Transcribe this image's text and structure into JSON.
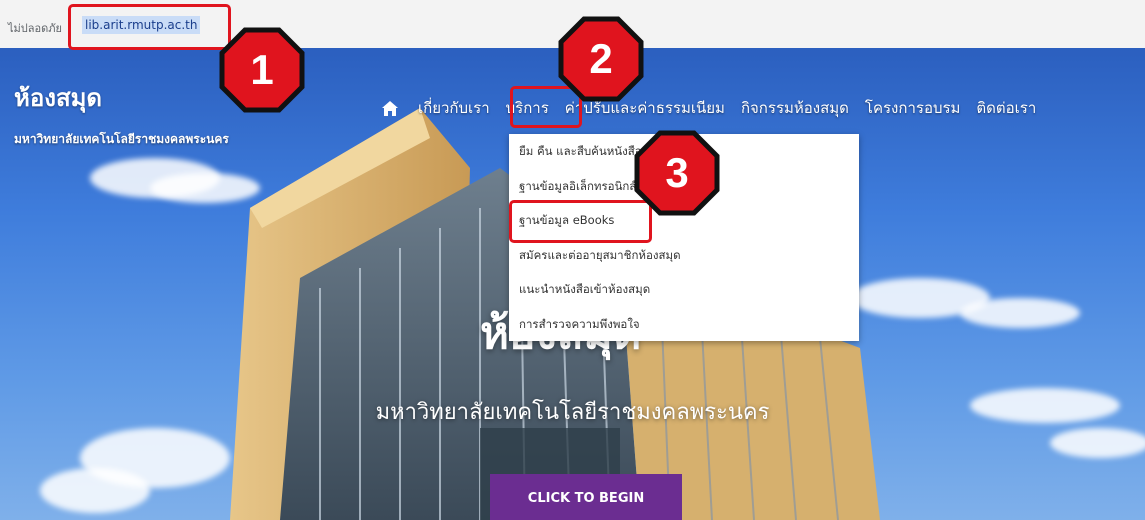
{
  "browser": {
    "insecure_label": "ไม่ปลอดภัย",
    "url": "lib.arit.rmutp.ac.th"
  },
  "site": {
    "title": "ห้องสมุด",
    "subtitle": "มหาวิทยาลัยเทคโนโลยีราชมงคลพระนคร"
  },
  "nav": {
    "home_icon": "home-icon",
    "items": [
      "เกี่ยวกับเรา",
      "บริการ",
      "ค่าปรับและค่าธรรมเนียม",
      "กิจกรรมห้องสมุด",
      "โครงการอบรม",
      "ติดต่อเรา"
    ]
  },
  "dropdown": {
    "items": [
      "ยืม คืน และสืบค้นหนังสือ (OPAC)",
      "ฐานข้อมูลอิเล็กทรอนิกส์",
      "ฐานข้อมูล eBooks",
      "สมัครและต่ออายุสมาชิกห้องสมุด",
      "แนะนำหนังสือเข้าห้องสมุด",
      "การสำรวจความพึงพอใจ"
    ]
  },
  "hero": {
    "heading": "ห้องสมุด",
    "subheading": "มหาวิทยาลัยเทคโนโลยีราชมงคลพระนคร",
    "cta_label": "CLICK TO BEGIN"
  },
  "annotations": {
    "steps": [
      "1",
      "2",
      "3"
    ],
    "color": "#e0141e"
  },
  "colors": {
    "cta": "#6b2d91",
    "sky": "#3f7ddc"
  }
}
